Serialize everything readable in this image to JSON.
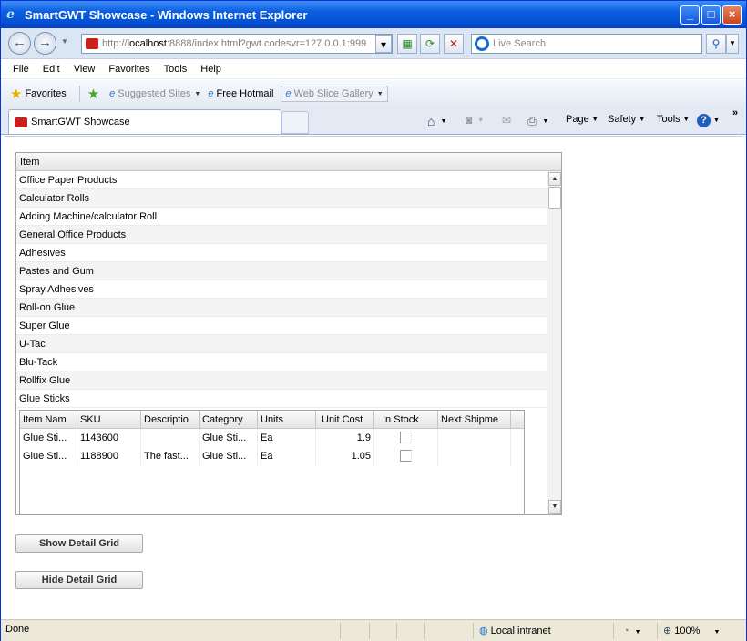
{
  "window": {
    "title": "SmartGWT Showcase - Windows Internet Explorer"
  },
  "address": {
    "url_prefix": "http://",
    "url_host": "localhost",
    "url_rest": ":8888/index.html?gwt.codesvr=127.0.0.1:999"
  },
  "search": {
    "placeholder": "Live Search"
  },
  "menu": [
    "File",
    "Edit",
    "View",
    "Favorites",
    "Tools",
    "Help"
  ],
  "favorites_bar": {
    "favorites": "Favorites",
    "suggested": "Suggested Sites",
    "hotmail": "Free Hotmail",
    "webslice": "Web Slice Gallery"
  },
  "tab": {
    "title": "SmartGWT Showcase"
  },
  "command_bar": {
    "page": "Page",
    "safety": "Safety",
    "tools": "Tools"
  },
  "master_grid": {
    "header": "Item",
    "rows": [
      "Office Paper Products",
      "Calculator Rolls",
      "Adding Machine/calculator Roll",
      "General Office Products",
      "Adhesives",
      "Pastes and Gum",
      "Spray Adhesives",
      "Roll-on Glue",
      "Super Glue",
      "U-Tac",
      "Blu-Tack",
      "Rollfix Glue",
      "Glue Sticks"
    ]
  },
  "detail_grid": {
    "columns": [
      "Item Nam",
      "SKU",
      "Descriptio",
      "Category",
      "Units",
      "Unit Cost",
      "In Stock",
      "Next Shipme"
    ],
    "rows": [
      {
        "item": "Glue Sti...",
        "sku": "1143600",
        "description": "",
        "category": "Glue Sti...",
        "units": "Ea",
        "cost": "1.9",
        "in_stock": false
      },
      {
        "item": "Glue Sti...",
        "sku": "1188900",
        "description": "The fast...",
        "category": "Glue Sti...",
        "units": "Ea",
        "cost": "1.05",
        "in_stock": false
      }
    ]
  },
  "buttons": {
    "show": "Show Detail Grid",
    "hide": "Hide Detail Grid"
  },
  "status_bar": {
    "text": "Done",
    "zone": "Local intranet",
    "zoom": "100%"
  }
}
